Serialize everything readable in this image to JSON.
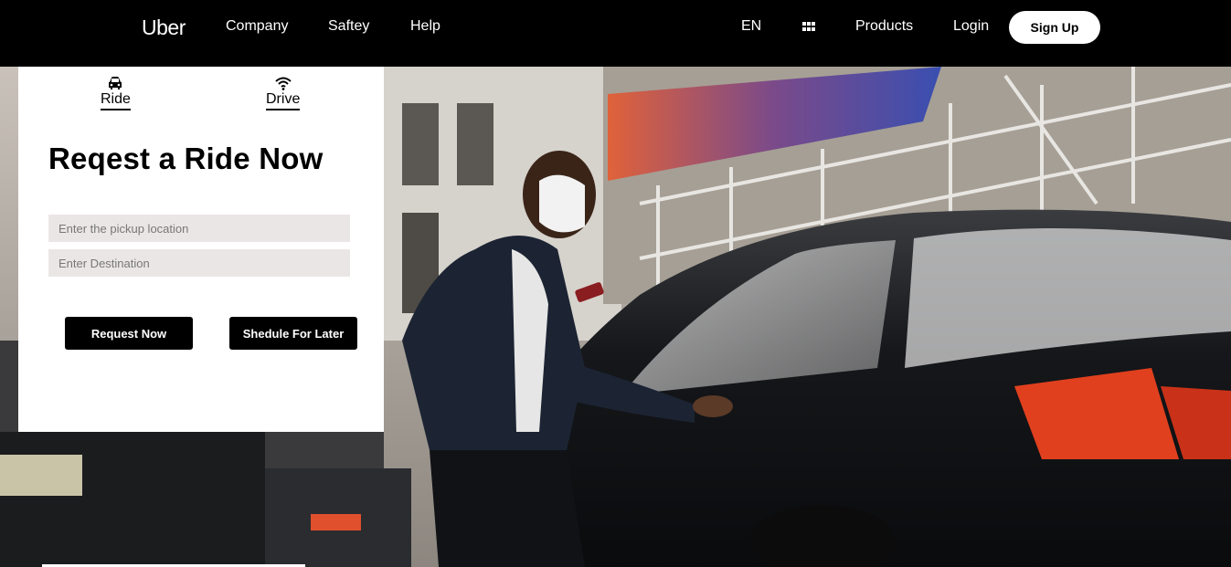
{
  "nav": {
    "logo": "Uber",
    "links": {
      "company": "Company",
      "safety": "Saftey",
      "help": "Help",
      "language": "EN",
      "products": "Products",
      "login": "Login"
    },
    "apps_icon": "grid-icon",
    "signup_label": "Sign Up"
  },
  "card": {
    "tabs": {
      "ride": {
        "label": "Ride",
        "icon": "car-icon"
      },
      "drive": {
        "label": "Drive",
        "icon": "wifi-icon"
      }
    },
    "title": "Reqest a Ride Now",
    "pickup_placeholder": "Enter the pickup location",
    "destination_placeholder": "Enter Destination",
    "request_label": "Request Now",
    "schedule_label": "Shedule For Later"
  },
  "colors": {
    "nav_bg": "#000000",
    "input_bg": "#ebe6e6",
    "button_bg": "#000000"
  }
}
